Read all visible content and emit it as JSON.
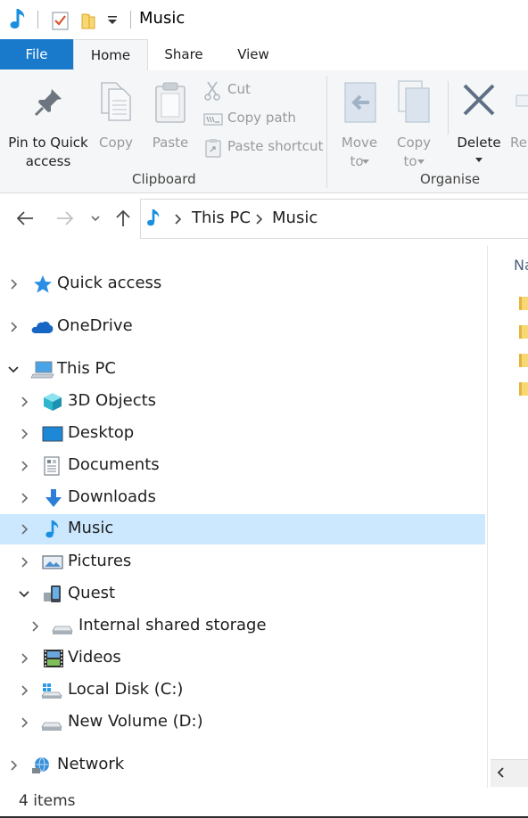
{
  "window": {
    "title": "Music"
  },
  "ribbon": {
    "tabs": [
      {
        "label": "File"
      },
      {
        "label": "Home"
      },
      {
        "label": "Share"
      },
      {
        "label": "View"
      }
    ],
    "clipboard": {
      "pin_label_line1": "Pin to Quick",
      "pin_label_line2": "access",
      "copy_label": "Copy",
      "paste_label": "Paste",
      "cut_label": "Cut",
      "copy_path_label": "Copy path",
      "paste_shortcut_label": "Paste shortcut",
      "group_label": "Clipboard"
    },
    "organise": {
      "move_to_line1": "Move",
      "move_to_line2": "to",
      "copy_to_line1": "Copy",
      "copy_to_line2": "to",
      "delete_label": "Delete",
      "rename_partial": "Rer",
      "group_label": "Organise"
    }
  },
  "address_bar": {
    "crumbs": [
      "This PC",
      "Music"
    ]
  },
  "nav_tree": {
    "items": [
      {
        "label": "Quick access",
        "icon": "star-icon",
        "expanded": false
      },
      {
        "label": "OneDrive",
        "icon": "cloud-icon",
        "expanded": false
      },
      {
        "label": "This PC",
        "icon": "computer-icon",
        "expanded": true
      },
      {
        "label": "3D Objects",
        "icon": "cube-icon",
        "expanded": false
      },
      {
        "label": "Desktop",
        "icon": "desktop-icon",
        "expanded": false
      },
      {
        "label": "Documents",
        "icon": "document-icon",
        "expanded": false
      },
      {
        "label": "Downloads",
        "icon": "download-arrow-icon",
        "expanded": false
      },
      {
        "label": "Music",
        "icon": "music-note-icon",
        "expanded": false,
        "selected": true
      },
      {
        "label": "Pictures",
        "icon": "pictures-icon",
        "expanded": false
      },
      {
        "label": "Quest",
        "icon": "device-icon",
        "expanded": true
      },
      {
        "label": "Internal shared storage",
        "icon": "drive-icon",
        "expanded": false
      },
      {
        "label": "Videos",
        "icon": "film-icon",
        "expanded": false
      },
      {
        "label": "Local Disk (C:)",
        "icon": "windows-drive-icon",
        "expanded": false
      },
      {
        "label": "New Volume (D:)",
        "icon": "drive-icon",
        "expanded": false
      },
      {
        "label": "Network",
        "icon": "network-icon",
        "expanded": false
      }
    ]
  },
  "content": {
    "column_header_partial": "Na"
  },
  "status_bar": {
    "item_count": "4 items"
  },
  "colors": {
    "accent": "#1979ca",
    "selection": "#cce8ff",
    "ribbon_bg": "#f5f6f7",
    "folder_yellow": "#f8d775"
  }
}
